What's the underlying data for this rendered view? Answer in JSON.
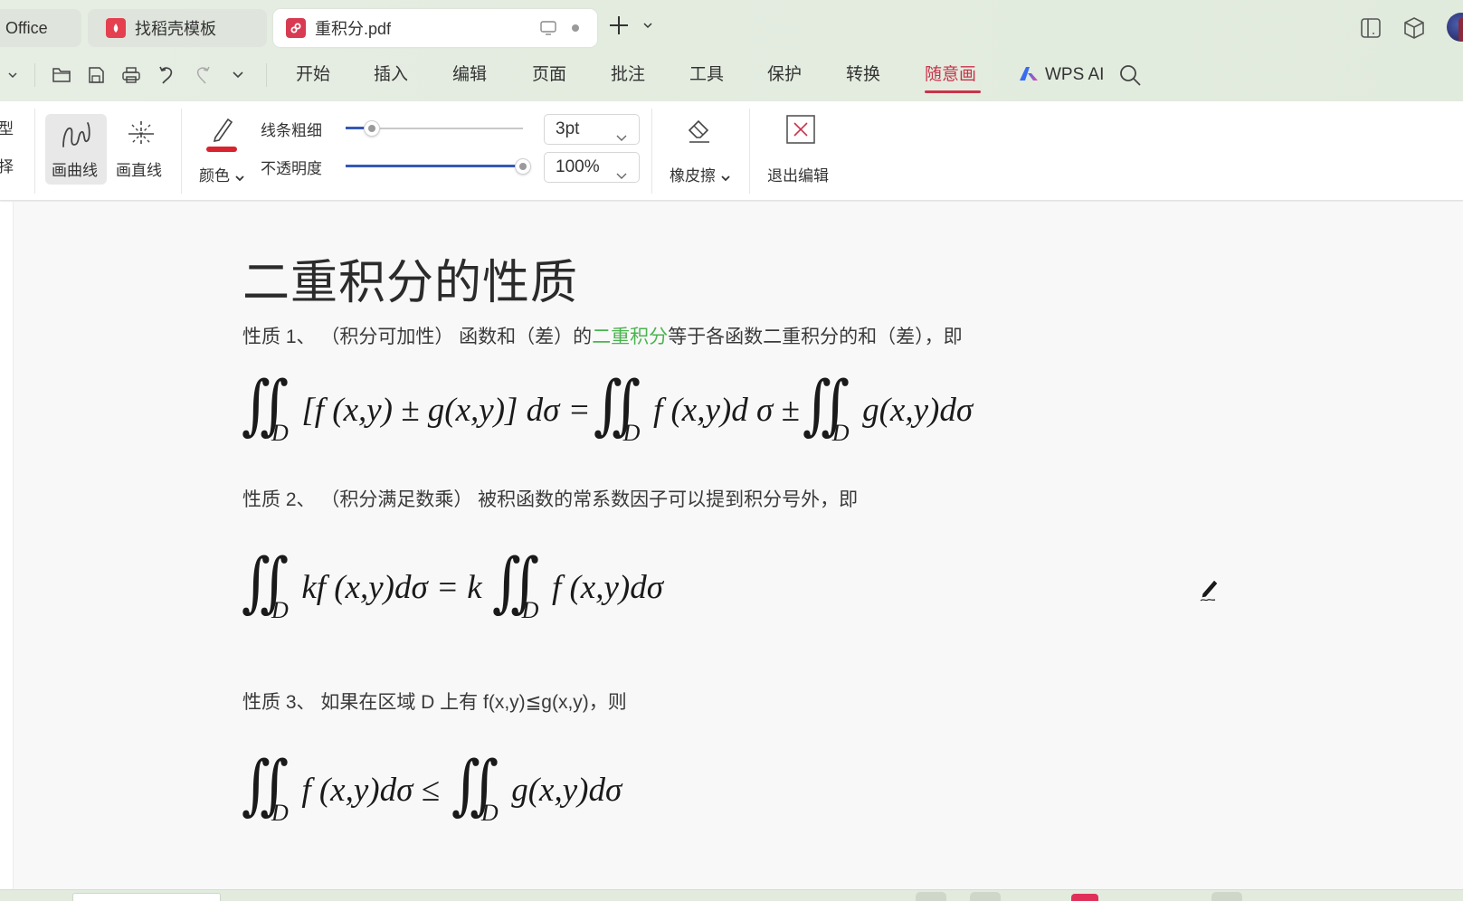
{
  "tabs": [
    {
      "label": "Office",
      "icon": "wps-office-icon",
      "active": false
    },
    {
      "label": "找稻壳模板",
      "icon": "docer-icon",
      "active": false
    },
    {
      "label": "重积分.pdf",
      "icon": "pdf-icon",
      "active": true
    }
  ],
  "tab_actions": {
    "new_tab": "+",
    "tab_menu": "chevron-down-icon"
  },
  "window_icons": [
    "layout-icon",
    "cube-icon",
    "avatar"
  ],
  "quick_access": [
    "chevron-down-icon",
    "folder-icon",
    "save-icon",
    "print-icon",
    "undo-icon",
    "redo-icon",
    "chevron-down-icon"
  ],
  "menu": {
    "items": [
      "开始",
      "插入",
      "编辑",
      "页面",
      "批注",
      "工具",
      "保护",
      "转换",
      "随意画"
    ],
    "active": "随意画",
    "wps_ai": "WPS AI",
    "accent": "#c8334a"
  },
  "ribbon": {
    "partial_left_top": "型",
    "partial_left_bottom": "择",
    "draw_curve": "画曲线",
    "draw_line": "画直线",
    "color_label": "颜色",
    "color_value": "#d8242f",
    "line_width_label": "线条粗细",
    "opacity_label": "不透明度",
    "line_width_value": "3pt",
    "line_width_fraction": 0.15,
    "opacity_value": "100%",
    "opacity_fraction": 1.0,
    "eraser": "橡皮擦",
    "exit_edit": "退出编辑"
  },
  "document": {
    "title": "二重积分的性质",
    "p1_before": "性质 1、 （积分可加性） 函数和（差）的",
    "p1_highlight": "二重积分",
    "p1_after": "等于各函数二重积分的和（差），即",
    "p1_highlight_color": "#4bb34f",
    "f1_lhs": "[f (x,y) ± g(x,y)] dσ = ",
    "f1_mid": "f (x,y)d σ ± ",
    "f1_rhs": "g(x,y)dσ",
    "p2": "性质 2、 （积分满足数乘） 被积函数的常系数因子可以提到积分号外，即",
    "f2_lhs": "kf (x,y)dσ = k",
    "f2_rhs": "f (x,y)dσ",
    "p3": "性质 3、 如果在区域 D 上有 f(x,y)≦g(x,y)，则",
    "f3_lhs": "f (x,y)dσ ≤",
    "f3_rhs": "g(x,y)dσ",
    "domain_symbol": "D",
    "integral_symbol": "∬"
  }
}
